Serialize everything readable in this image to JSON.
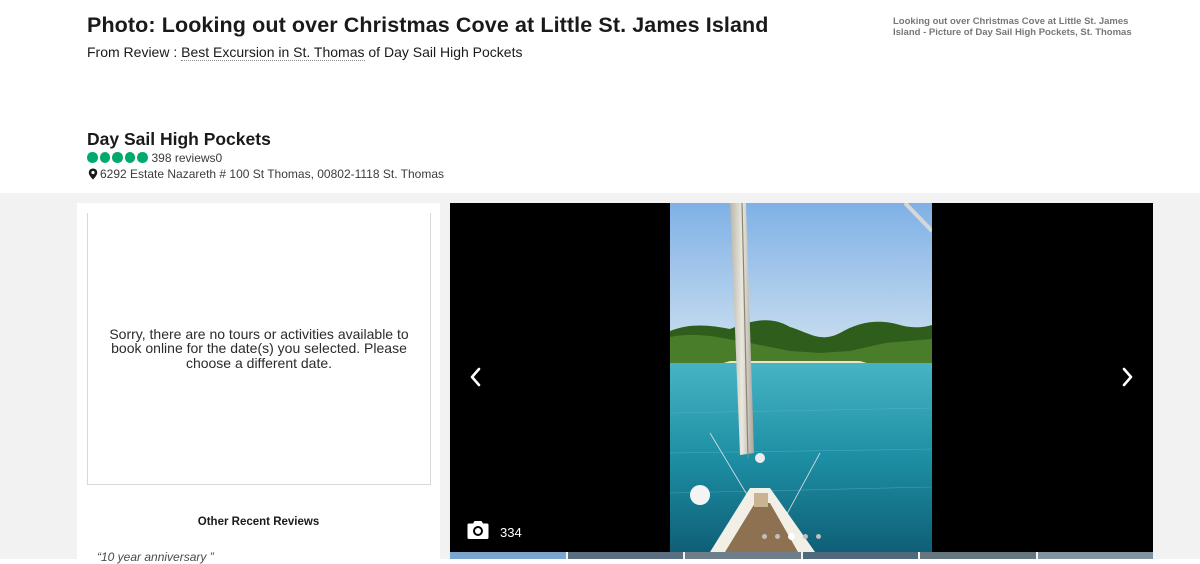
{
  "header": {
    "photo_title": "Photo: Looking out over Christmas Cove at Little St. James Island",
    "from_review_prefix": "From Review : ",
    "review_link": "Best Excursion in St. Thomas",
    "of_text": " of ",
    "business_link": "Day Sail High Pockets",
    "alt_caption": "Looking out over Christmas Cove at Little St. James Island - Picture of Day Sail High Pockets, St. Thomas"
  },
  "business": {
    "name": "Day Sail High Pockets",
    "rating_bubbles": 5,
    "reviews_count": "398 reviews0",
    "address": "6292 Estate Nazareth # 100 St Thomas, 00802-1118 St. Thomas"
  },
  "left_panel": {
    "notice": "Sorry, there are no tours or activities available to book online for the date(s) you selected. Please choose a different date.",
    "other_reviews_heading": "Other Recent Reviews",
    "review_quote": "“10 year anniversary ”"
  },
  "viewer": {
    "photo_count": "334",
    "dot_count": 5,
    "active_dot": 2
  },
  "icons": {
    "prev": "chevron-left-icon",
    "next": "chevron-right-icon",
    "camera": "camera-icon",
    "pin": "map-pin-icon"
  },
  "colors": {
    "rating_green": "#00aa6c",
    "page_background": "#f2f2f2",
    "viewer_background": "#000000"
  }
}
